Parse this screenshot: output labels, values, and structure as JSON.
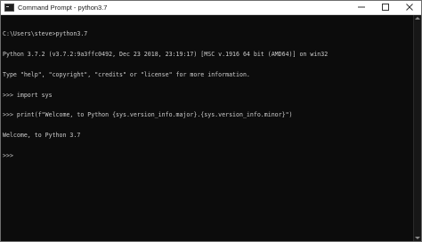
{
  "window": {
    "title": "Command Prompt - python3.7",
    "colors": {
      "background": "#0c0c0c",
      "text": "#cccccc",
      "titlebar": "#ffffff"
    }
  },
  "titlebar": {
    "icon": "command-prompt-icon",
    "controls": {
      "minimize_icon": "minimize-icon",
      "maximize_icon": "maximize-icon",
      "close_icon": "close-icon"
    }
  },
  "console": {
    "lines": [
      "C:\\Users\\steve>python3.7",
      "Python 3.7.2 (v3.7.2:9a3ffc0492, Dec 23 2018, 23:19:17) [MSC v.1916 64 bit (AMD64)] on win32",
      "Type \"help\", \"copyright\", \"credits\" or \"license\" for more information.",
      ">>> import sys",
      ">>> print(f\"Welcome, to Python {sys.version_info.major}.{sys.version_info.minor}\")",
      "Welcome, to Python 3.7",
      ">>>"
    ]
  }
}
